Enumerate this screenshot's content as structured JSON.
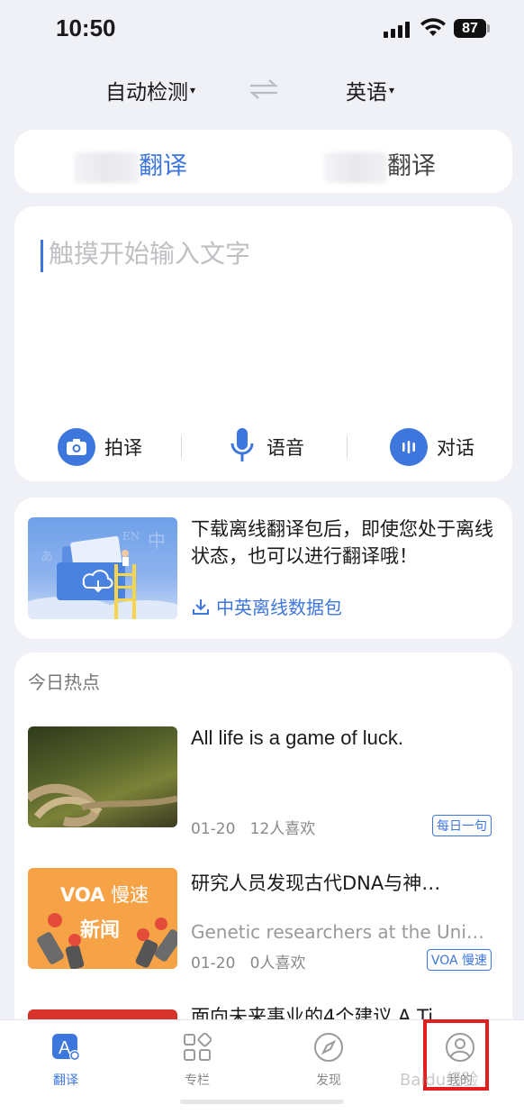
{
  "status": {
    "time": "10:50",
    "battery": "87"
  },
  "lang": {
    "source": "自动检测",
    "target": "英语"
  },
  "modes": [
    {
      "label": "翻译"
    },
    {
      "label": "翻译"
    }
  ],
  "input": {
    "placeholder": "触摸开始输入文字"
  },
  "tools": [
    {
      "label": "拍译"
    },
    {
      "label": "语音"
    },
    {
      "label": "对话"
    }
  ],
  "promo": {
    "text": "下载离线翻译包后，即使您处于离线状态，也可以进行翻译哦！",
    "link": "中英离线数据包"
  },
  "hot": {
    "title": "今日热点",
    "articles": [
      {
        "title": "All life is a game of luck.",
        "subtitle": "",
        "date": "01-20",
        "likes": "12人喜欢",
        "tag": "每日一句"
      },
      {
        "title": "研究人员发现古代DNA与神…",
        "subtitle": "Genetic researchers at the Uni…",
        "date": "01-20",
        "likes": "0人喜欢",
        "tag": "VOA 慢速",
        "thumb_brand": "VOA",
        "thumb_line1": "慢速",
        "thumb_line2": "新闻"
      },
      {
        "title": "面向未来事业的4个建议 A Ti…"
      }
    ]
  },
  "tabbar": [
    {
      "label": "翻译",
      "active": true
    },
    {
      "label": "专栏"
    },
    {
      "label": "发现"
    },
    {
      "label": "我的"
    }
  ],
  "watermark": "Baidu经验",
  "colors": {
    "accent": "#3d76dd",
    "highlight": "#e02020",
    "background": "#f0f1f6"
  }
}
